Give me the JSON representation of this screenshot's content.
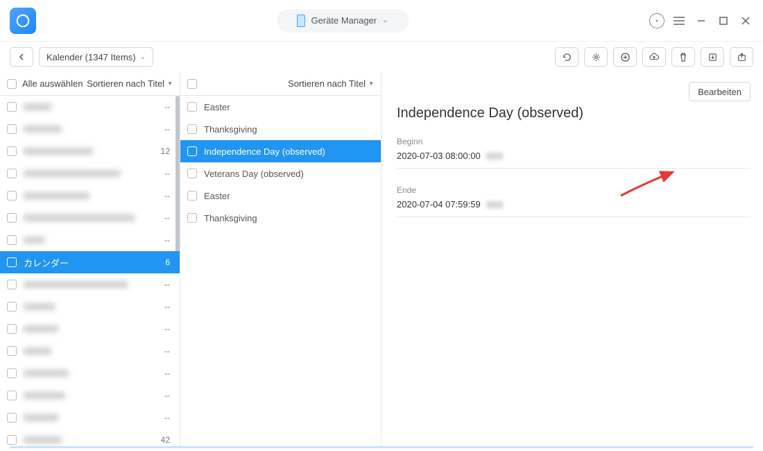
{
  "header": {
    "device_label": "Geräte Manager"
  },
  "toolbar": {
    "breadcrumb": "Kalender (1347 Items)"
  },
  "col1": {
    "select_all": "Alle auswählen",
    "sort": "Sortieren nach Titel",
    "items": [
      {
        "label": "",
        "count": "--"
      },
      {
        "label": "",
        "count": "--"
      },
      {
        "label": "",
        "count": "12"
      },
      {
        "label": "",
        "count": "--"
      },
      {
        "label": "",
        "count": "--"
      },
      {
        "label": "",
        "count": "--"
      },
      {
        "label": "",
        "count": "--"
      },
      {
        "label": "カレンダー",
        "count": "6",
        "selected": true
      },
      {
        "label": "",
        "count": "--"
      },
      {
        "label": "",
        "count": "--"
      },
      {
        "label": "",
        "count": "--"
      },
      {
        "label": "",
        "count": "--"
      },
      {
        "label": "",
        "count": "--"
      },
      {
        "label": "",
        "count": "--"
      },
      {
        "label": "",
        "count": "--"
      },
      {
        "label": "",
        "count": "42"
      }
    ]
  },
  "col2": {
    "sort": "Sortieren nach Titel",
    "items": [
      {
        "label": "Easter"
      },
      {
        "label": "Thanksgiving"
      },
      {
        "label": "Independence Day (observed)",
        "selected": true
      },
      {
        "label": "Veterans Day (observed)"
      },
      {
        "label": "Easter"
      },
      {
        "label": "Thanksgiving"
      }
    ]
  },
  "detail": {
    "title": "Independence Day (observed)",
    "begin_label": "Beginn",
    "begin_value": "2020-07-03 08:00:00",
    "end_label": "Ende",
    "end_value": "2020-07-04 07:59:59",
    "edit_button": "Bearbeiten"
  }
}
